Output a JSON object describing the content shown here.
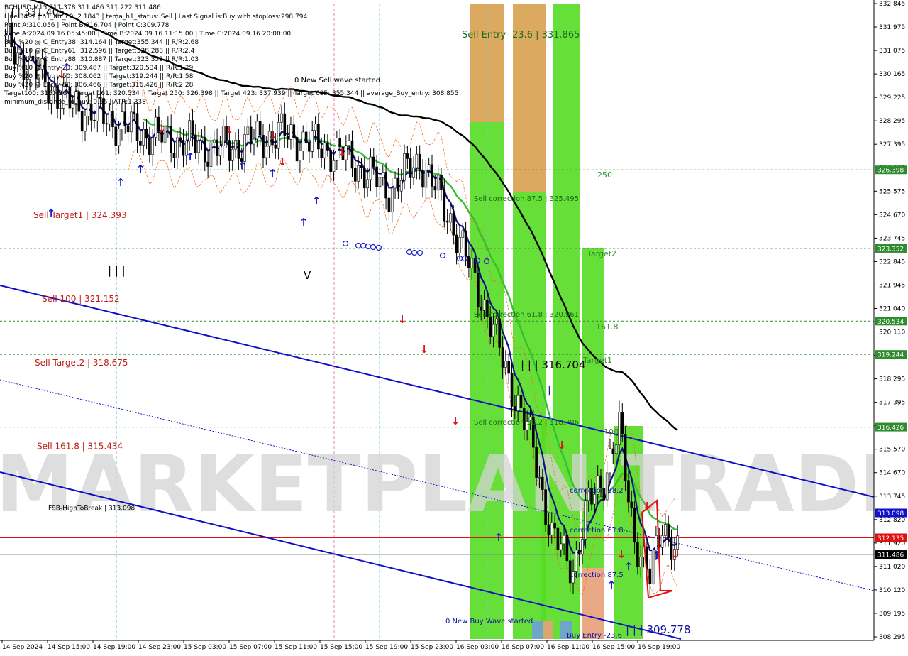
{
  "chart_data": {
    "type": "candlestick",
    "symbol_header": "BCHUSD,M15  311.378 311.486 311.222 311.486",
    "info_lines": [
      "Line:3492 | h1_atr_c0: 2.1843 | tema_h1_status: Sell | Last Signal is:Buy with stoploss:298.794",
      "Point A:310.056 | Point B:316.704 | Point C:309.778",
      "Time A:2024.09.16 05:45:00 | Time B:2024.09.16 11:15:00 | Time C:2024.09.16 20:00:00",
      "Buy %20 @ C_Entry38: 314.164 || Target:355.344 || R/R:2.68",
      "Buy %10 @ C_Entry61: 312.596 || Target:328.288 || R/R:2.4",
      "Buy %10 @ C_Entry88: 310.887 || Target:323.352 || R/R:1.03",
      "Buy %10 @ Entry-23: 309.487 || Target:320.534 || R/R:1.29",
      "Buy %20 @ Entry-50: 308.062 || Target:319.244 || R/R:1.58",
      "Buy %20 @ Entry-88: 306.466 || Target:316.426 || R/R:2.28",
      "Target100: 316.426 || Target 161: 320.534 || Target 250: 326.398 || Target 423: 337.939 || Target 685: 355.344 || average_Buy_entry: 308.855",
      "minimum_distance_to_buy: 0.56 | ATR:1.338"
    ],
    "watermark": "MARKETPLAN TRADE",
    "y_axis_ticks": [
      "332.845",
      "331.975",
      "331.075",
      "330.165",
      "329.225",
      "328.295",
      "327.395",
      "326.465",
      "325.575",
      "324.670",
      "323.745",
      "322.845",
      "321.945",
      "321.040",
      "320.110",
      "319.210",
      "318.295",
      "317.395",
      "316.425",
      "315.570",
      "314.670",
      "313.745",
      "312.820",
      "311.920",
      "311.020",
      "310.120",
      "309.195",
      "308.295"
    ],
    "x_axis_ticks": [
      "14 Sep 2024",
      "14 Sep 15:00",
      "14 Sep 19:00",
      "14 Sep 23:00",
      "15 Sep 03:00",
      "15 Sep 07:00",
      "15 Sep 11:00",
      "15 Sep 15:00",
      "15 Sep 19:00",
      "15 Sep 23:00",
      "16 Sep 03:00",
      "16 Sep 07:00",
      "16 Sep 11:00",
      "16 Sep 15:00",
      "16 Sep 19:00"
    ],
    "y_range": [
      308.295,
      332.845
    ],
    "price_level_labels": [
      {
        "text": "326.398",
        "value": 326.398,
        "bg": "#2e8b2e",
        "fg": "#ffffff"
      },
      {
        "text": "323.352",
        "value": 323.352,
        "bg": "#2e8b2e",
        "fg": "#ffffff"
      },
      {
        "text": "320.534",
        "value": 320.534,
        "bg": "#2e8b2e",
        "fg": "#ffffff"
      },
      {
        "text": "319.244",
        "value": 319.244,
        "bg": "#2e8b2e",
        "fg": "#ffffff"
      },
      {
        "text": "316.426",
        "value": 316.426,
        "bg": "#2e8b2e",
        "fg": "#ffffff"
      },
      {
        "text": "313.098",
        "value": 313.098,
        "bg": "#1010c8",
        "fg": "#ffffff"
      },
      {
        "text": "312.135",
        "value": 312.135,
        "bg": "#e01010",
        "fg": "#ffffff"
      },
      {
        "text": "311.486",
        "value": 311.486,
        "bg": "#000000",
        "fg": "#ffffff"
      }
    ],
    "left_annotations": [
      {
        "text": "Sell Target1 | 324.393",
        "value": 324.393,
        "color": "#c0201a"
      },
      {
        "text": "Sell 100 | 321.152",
        "value": 321.152,
        "color": "#c0201a"
      },
      {
        "text": "Sell Target2 | 318.675",
        "value": 318.675,
        "color": "#c0201a"
      },
      {
        "text": "Sell 161.8 | 315.434",
        "value": 315.434,
        "color": "#c0201a"
      },
      {
        "text": "FSB-HighToBreak | 313.098",
        "value": 313.098,
        "color": "#000000"
      }
    ],
    "zone_annotations": [
      {
        "text": "Sell Entry -23.6 | 331.865",
        "color": "#1a6b1a"
      },
      {
        "text": "Sell correction 87.5 | 325.495",
        "color": "#1a6b1a"
      },
      {
        "text": "Sell correction 61.8 | 320.961",
        "color": "#1a6b1a"
      },
      {
        "text": "Sell correction 38.2 | 318.796",
        "color": "#1a6b1a"
      },
      {
        "text": "0 New Sell wave started",
        "color": "#000000"
      },
      {
        "text": "0 New Buy Wave started",
        "color": "#1010a0"
      },
      {
        "text": "250",
        "color": "#2e8b2e"
      },
      {
        "text": "Target2",
        "color": "#2e8b2e"
      },
      {
        "text": "161.8",
        "color": "#2e8b2e"
      },
      {
        "text": "Target1",
        "color": "#2e8b2e"
      },
      {
        "text": "100",
        "color": "#2e8b2e"
      },
      {
        "text": "correction 38.2",
        "color": "#1010a0"
      },
      {
        "text": "correction 61.8",
        "color": "#1010a0"
      },
      {
        "text": "correction 87.5",
        "color": "#1010a0"
      },
      {
        "text": "Buy Entry -23.6",
        "color": "#1010a0"
      },
      {
        "text": "| | | 316.704",
        "color": "#000000"
      },
      {
        "text": "| | | 309.778",
        "color": "#1010a0"
      },
      {
        "text": "| | |",
        "color": "#000000"
      },
      {
        "text": "V",
        "color": "#000000"
      },
      {
        "text": "|",
        "color": "#1010a0"
      },
      {
        "text": "| | | 331.405",
        "color": "#000000"
      }
    ],
    "colors": {
      "zone_green": "#55dd22",
      "zone_orange": "#d8a050",
      "zone_salmon": "#e8a078",
      "zone_blue": "#6fa0d8",
      "ema_dark": "#101080",
      "ema_green": "#30c030",
      "ma_black": "#000000",
      "channel": "#1010c8"
    }
  }
}
